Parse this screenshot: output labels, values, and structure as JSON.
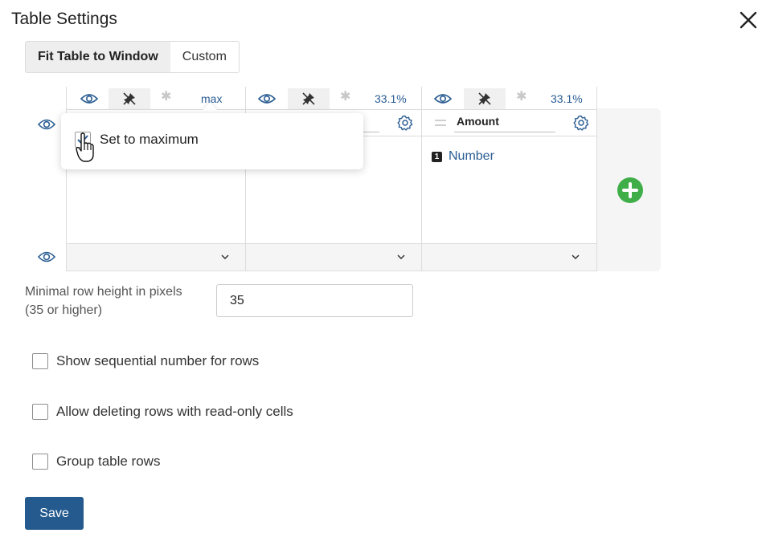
{
  "dialog": {
    "title": "Table Settings"
  },
  "tabs": [
    {
      "label": "Fit Table to Window",
      "active": true
    },
    {
      "label": "Custom",
      "active": false
    }
  ],
  "columns": [
    {
      "width_label": "max",
      "header": "",
      "content": ""
    },
    {
      "width_label": "33.1%",
      "header": "",
      "content": ""
    },
    {
      "width_label": "33.1%",
      "header": "Amount",
      "content": "Number",
      "content_badge": "1"
    }
  ],
  "popup": {
    "checkbox_label": "Set to maximum",
    "checked": true
  },
  "form": {
    "min_row_height_label": "Minimal row height in pixels (35 or higher)",
    "min_row_height_value": "35",
    "checkboxes": [
      {
        "label": "Show sequential number for rows",
        "checked": false
      },
      {
        "label": "Allow deleting rows with read-only cells",
        "checked": false
      },
      {
        "label": "Group table rows",
        "checked": false
      }
    ]
  },
  "buttons": {
    "save": "Save"
  },
  "colors": {
    "accent": "#245a8e",
    "link": "#2a5d93",
    "add_green": "#3fae49"
  }
}
